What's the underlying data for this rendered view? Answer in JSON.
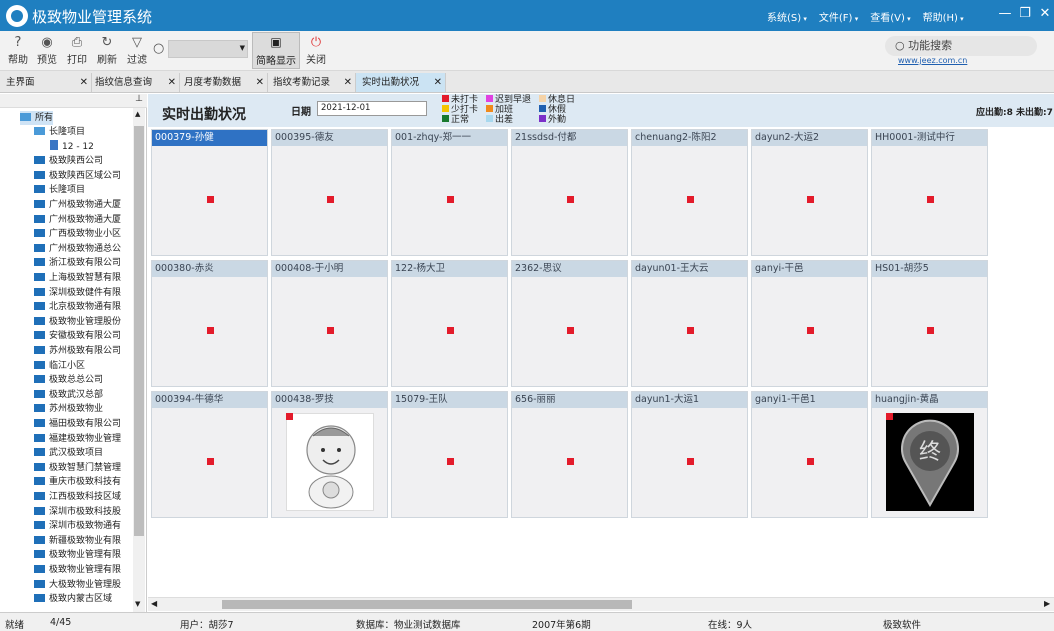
{
  "app": {
    "title": "极致物业管理系统",
    "menus": [
      "系统(S)",
      "文件(F)",
      "查看(V)",
      "帮助(H)"
    ]
  },
  "toolbar": {
    "buttons": [
      {
        "label": "帮助",
        "icon": "help-icon"
      },
      {
        "label": "预览",
        "icon": "eye-icon"
      },
      {
        "label": "打印",
        "icon": "printer-icon"
      },
      {
        "label": "刷新",
        "icon": "refresh-icon"
      },
      {
        "label": "过滤",
        "icon": "filter-icon"
      }
    ],
    "brief_label": "简略显示",
    "close_label": "关闭",
    "function_search": "功能搜索",
    "url": "www.jeez.com.cn"
  },
  "tabs": [
    "主界面",
    "指纹信息查询",
    "月度考勤数据",
    "指纹考勤记录",
    "实时出勤状况"
  ],
  "sidebar": {
    "root": "所有",
    "items": [
      "长隆项目",
      "12 - 12",
      "极致陕西公司",
      "极致陕西区域公司",
      "长隆项目",
      "广州极致物通大厦",
      "广州极致物通大厦",
      "广西极致物业小区",
      "广州极致物通总公",
      "浙江极致有限公司",
      "上海极致智慧有限",
      "深圳极致健件有限",
      "北京极致物通有限",
      "极致物业管理股份",
      "安徽极致有限公司",
      "苏州极致有限公司",
      "临江小区",
      "极致总总公司",
      "极致武汉总部",
      "苏州极致物业",
      "福田极致有限公司",
      "福建极致物业管理",
      "武汉极致项目",
      "极致智慧门禁管理",
      "重庆市极致科技有",
      "江西极致科技区域",
      "深圳市极致科技股",
      "深圳市极致物通有",
      "新疆极致物业有限",
      "极致物业管理有限",
      "极致物业管理有限",
      "大极致物业管理股",
      "极致内蒙古区域"
    ]
  },
  "main": {
    "title": "实时出勤状况",
    "date_label": "日期",
    "date_value": "2021-12-01",
    "legend": [
      {
        "label": "未打卡",
        "color": "#e31b2b"
      },
      {
        "label": "少打卡",
        "color": "#f5c400"
      },
      {
        "label": "正常",
        "color": "#1a7a2e"
      },
      {
        "label": "迟到早退",
        "color": "#e040e0"
      },
      {
        "label": "加班",
        "color": "#f08a1c"
      },
      {
        "label": "出差",
        "color": "#a8d8ee"
      },
      {
        "label": "休息日",
        "color": "#f5d3a8"
      },
      {
        "label": "休假",
        "color": "#1f5fb0"
      },
      {
        "label": "外勤",
        "color": "#7b2fc9"
      }
    ],
    "summary": "应出勤:8 未出勤:7",
    "cards": [
      "000379-孙健",
      "000395-德友",
      "001-zhqy-郑一一",
      "21ssdsd-付都",
      "chenuang2-陈阳2",
      "dayun2-大运2",
      "HH0001-测试中行",
      "000380-赤炎",
      "000408-于小明",
      "122-杨大卫",
      "2362-思议",
      "dayun01-王大云",
      "ganyi-干邑",
      "HS01-胡莎5",
      "000394-牛德华",
      "000438-罗技",
      "15079-王队",
      "656-丽丽",
      "dayun1-大运1",
      "ganyi1-干邑1",
      "huangjin-黄晶"
    ]
  },
  "status": {
    "ready": "就绪",
    "count": "4/45",
    "user": "用户：胡莎7",
    "db": "数据库：物业测试数据库",
    "period": "2007年第6期",
    "online": "在线：9人",
    "brand": "极致软件"
  }
}
